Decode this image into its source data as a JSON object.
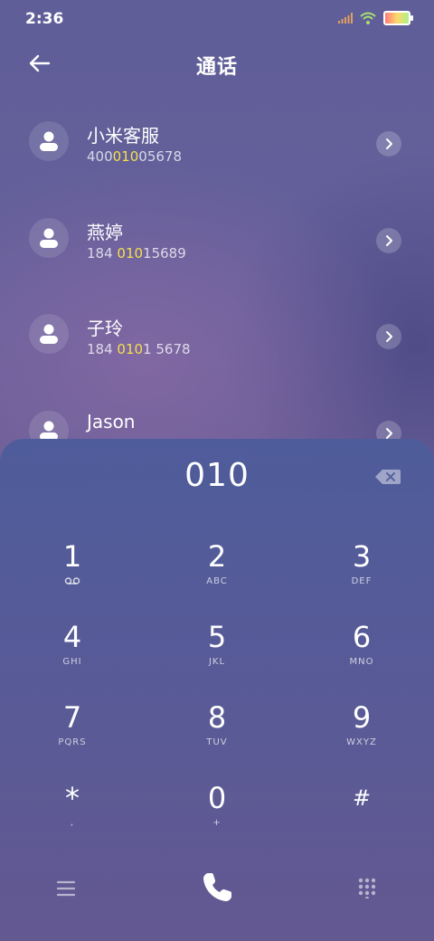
{
  "status": {
    "time": "2:36"
  },
  "header": {
    "title": "通话"
  },
  "contacts": [
    {
      "name": "小米客服",
      "number_pre": "400",
      "number_hl": "010",
      "number_post": "05678"
    },
    {
      "name": "燕婷",
      "number_pre": "184 ",
      "number_hl": "010",
      "number_post": "15689"
    },
    {
      "name": "子玲",
      "number_pre": "184 ",
      "number_hl": "010",
      "number_post": "1 5678"
    },
    {
      "name": "Jason",
      "number_pre": "",
      "number_hl": "",
      "number_post": ""
    }
  ],
  "dialpad": {
    "entered": "010",
    "keys": [
      {
        "digit": "1",
        "letters": ""
      },
      {
        "digit": "2",
        "letters": "ABC"
      },
      {
        "digit": "3",
        "letters": "DEF"
      },
      {
        "digit": "4",
        "letters": "GHI"
      },
      {
        "digit": "5",
        "letters": "JKL"
      },
      {
        "digit": "6",
        "letters": "MNO"
      },
      {
        "digit": "7",
        "letters": "PQRS"
      },
      {
        "digit": "8",
        "letters": "TUV"
      },
      {
        "digit": "9",
        "letters": "WXYZ"
      },
      {
        "digit": "*",
        "letters": ","
      },
      {
        "digit": "0",
        "letters": "+"
      },
      {
        "digit": "#",
        "letters": ""
      }
    ]
  },
  "icons": {
    "back": "arrow-left-icon",
    "chevron": "chevron-right-icon",
    "delete": "backspace-icon",
    "voicemail": "voicemail-icon",
    "menu": "menu-icon",
    "call": "phone-icon",
    "keypad": "dialpad-icon"
  },
  "colors": {
    "highlight": "#f5e04a"
  }
}
